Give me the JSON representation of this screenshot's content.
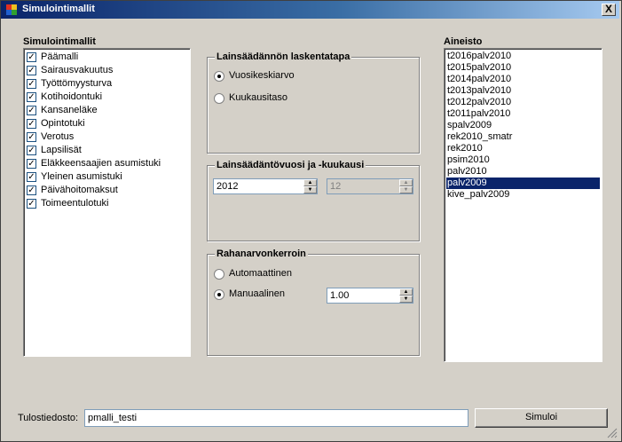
{
  "window": {
    "title": "Simulointimallit",
    "close_label": "X"
  },
  "models": {
    "label": "Simulointimallit",
    "items": [
      {
        "label": "Päämalli",
        "checked": true
      },
      {
        "label": "Sairausvakuutus",
        "checked": true
      },
      {
        "label": "Työttömyysturva",
        "checked": true
      },
      {
        "label": "Kotihoidontuki",
        "checked": true
      },
      {
        "label": "Kansaneläke",
        "checked": true
      },
      {
        "label": "Opintotuki",
        "checked": true
      },
      {
        "label": "Verotus",
        "checked": true
      },
      {
        "label": "Lapsilisät",
        "checked": true
      },
      {
        "label": "Eläkkeensaajien asumistuki",
        "checked": true
      },
      {
        "label": "Yleinen asumistuki",
        "checked": true
      },
      {
        "label": "Päivähoitomaksut",
        "checked": true
      },
      {
        "label": "Toimeentulotuki",
        "checked": true
      }
    ]
  },
  "calc_method": {
    "title": "Lainsäädännön laskentatapa",
    "options": [
      "Vuosikeskiarvo",
      "Kuukausitaso"
    ],
    "selected": "Vuosikeskiarvo"
  },
  "legislation": {
    "title": "Lainsäädäntövuosi ja -kuukausi",
    "year": "2012",
    "month": "12"
  },
  "money_coef": {
    "title": "Rahanarvonkerroin",
    "options": [
      "Automaattinen",
      "Manuaalinen"
    ],
    "selected": "Manuaalinen",
    "value": "1.00"
  },
  "dataset": {
    "label": "Aineisto",
    "items": [
      "t2016palv2010",
      "t2015palv2010",
      "t2014palv2010",
      "t2013palv2010",
      "t2012palv2010",
      "t2011palv2010",
      "spalv2009",
      "rek2010_smatr",
      "rek2010",
      "psim2010",
      "palv2010",
      "palv2009",
      "kive_palv2009"
    ],
    "selected": "palv2009"
  },
  "output": {
    "label": "Tulostiedosto:",
    "value": "pmalli_testi"
  },
  "simulate_button": "Simuloi",
  "colors": {
    "titlebar": "#0a246a",
    "selection": "#0a246a",
    "face": "#d4d0c8"
  }
}
